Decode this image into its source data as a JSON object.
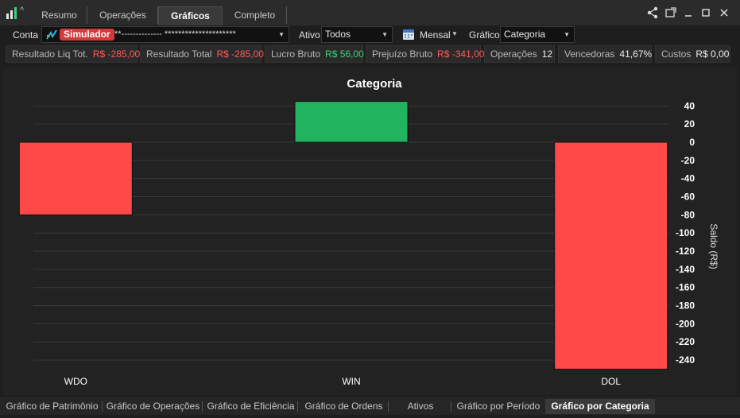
{
  "tabs": [
    {
      "label": "Resumo"
    },
    {
      "label": "Operações"
    },
    {
      "label": "Gráficos"
    },
    {
      "label": "Completo"
    }
  ],
  "active_tab": "Gráficos",
  "filters": {
    "conta_label": "Conta",
    "account_badge": "Simulador",
    "account_masked": "**-------------- *********************",
    "ativo_label": "Ativo",
    "ativo_value": "Todos",
    "periodo_value": "Mensal",
    "grafico_label": "Gráfico",
    "grafico_value": "Categoria"
  },
  "stats": [
    {
      "label": "Resultado Liq Tot.",
      "value": "R$ -285,00",
      "tone": "neg"
    },
    {
      "label": "Resultado Total",
      "value": "R$ -285,00",
      "tone": "neg"
    },
    {
      "label": "Lucro Bruto",
      "value": "R$ 56,00",
      "tone": "pos"
    },
    {
      "label": "Prejuízo Bruto",
      "value": "R$ -341,00",
      "tone": "neg"
    },
    {
      "label": "Operações",
      "value": "12",
      "tone": "neu"
    },
    {
      "label": "Vencedoras",
      "value": "41,67%",
      "tone": "neu"
    },
    {
      "label": "Custos",
      "value": "R$ 0,00",
      "tone": "neu"
    }
  ],
  "chart_data": {
    "type": "bar",
    "title": "Categoria",
    "ylabel": "Saldo (R$)",
    "xlabel": "",
    "categories": [
      "WDO",
      "WIN",
      "DOL"
    ],
    "values": [
      -80,
      45,
      -250
    ],
    "ylim": [
      -250,
      45
    ],
    "yticks": [
      40,
      20,
      0,
      -20,
      -40,
      -60,
      -80,
      -100,
      -120,
      -140,
      -160,
      -180,
      -200,
      -220,
      -240
    ],
    "colors": {
      "positive": "#22b35e",
      "negative": "#ff4848"
    },
    "grid": true
  },
  "bottom_tabs": [
    {
      "label": "Gráfico de Patrimônio"
    },
    {
      "label": "Gráfico de Operações"
    },
    {
      "label": "Gráfico de Eficiência"
    },
    {
      "label": "Gráfico de Ordens"
    },
    {
      "label": "Ativos"
    },
    {
      "label": "Gráfico por Período"
    },
    {
      "label": "Gráfico por Categoria"
    }
  ],
  "active_bottom_tab": "Gráfico por Categoria",
  "icons": {
    "app": "bar-chart-logo-icon",
    "share": "share-icon",
    "popout": "popout-window-icon",
    "minimize": "minimize-icon",
    "maximize": "maximize-icon",
    "close": "close-icon",
    "calendar": "calendar-icon"
  }
}
